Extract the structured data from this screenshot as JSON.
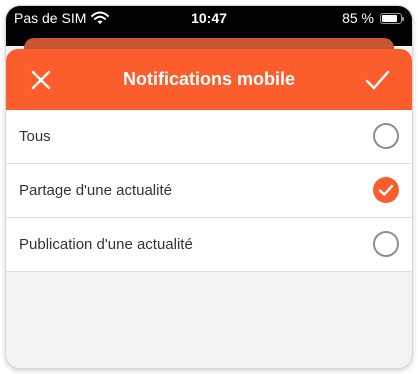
{
  "status_bar": {
    "carrier": "Pas de SIM",
    "time": "10:47",
    "battery": "85 %",
    "battery_level": 0.85,
    "icons": [
      "wifi-icon",
      "battery-icon"
    ]
  },
  "header": {
    "title": "Notifications mobile",
    "close_icon": "close-icon",
    "confirm_icon": "check-icon",
    "background_color": "#fb5d2c"
  },
  "options": [
    {
      "label": "Tous",
      "selected": false
    },
    {
      "label": "Partage d'une actualité",
      "selected": true
    },
    {
      "label": "Publication d'une actualité",
      "selected": false
    }
  ],
  "colors": {
    "accent": "#fb5d2c",
    "background": "#f2f2f4",
    "radio_unselected": "#8d8d8d"
  }
}
